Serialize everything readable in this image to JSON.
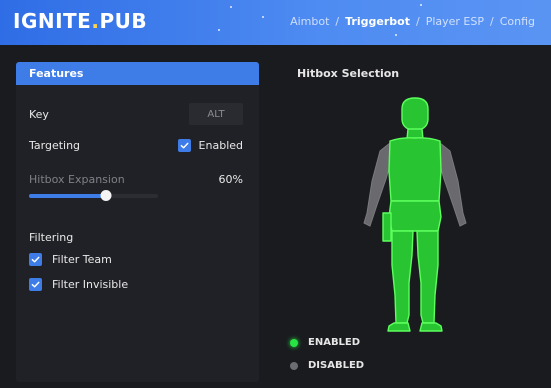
{
  "header": {
    "logo_main": "IGNITE",
    "logo_dot": ".",
    "logo_suffix": "PUB",
    "nav": [
      {
        "label": "Aimbot",
        "active": false
      },
      {
        "label": "Triggerbot",
        "active": true
      },
      {
        "label": "Player ESP",
        "active": false
      },
      {
        "label": "Config",
        "active": false
      }
    ],
    "separator": "/"
  },
  "features": {
    "title": "Features",
    "key_label": "Key",
    "key_value": "ALT",
    "targeting_label": "Targeting",
    "targeting_checkbox_label": "Enabled",
    "targeting_checked": true,
    "hitbox_expansion_label": "Hitbox Expansion",
    "hitbox_expansion_value": "60%",
    "hitbox_expansion_fraction": 0.6,
    "filtering_label": "Filtering",
    "filter_team_label": "Filter Team",
    "filter_team_checked": true,
    "filter_invisible_label": "Filter Invisible",
    "filter_invisible_checked": true
  },
  "hitbox": {
    "title": "Hitbox Selection",
    "legend_enabled": "ENABLED",
    "legend_disabled": "DISABLED"
  },
  "colors": {
    "accent": "#3e7ce8",
    "enabled_green": "#27e344",
    "disabled_gray": "#6c6d72"
  }
}
